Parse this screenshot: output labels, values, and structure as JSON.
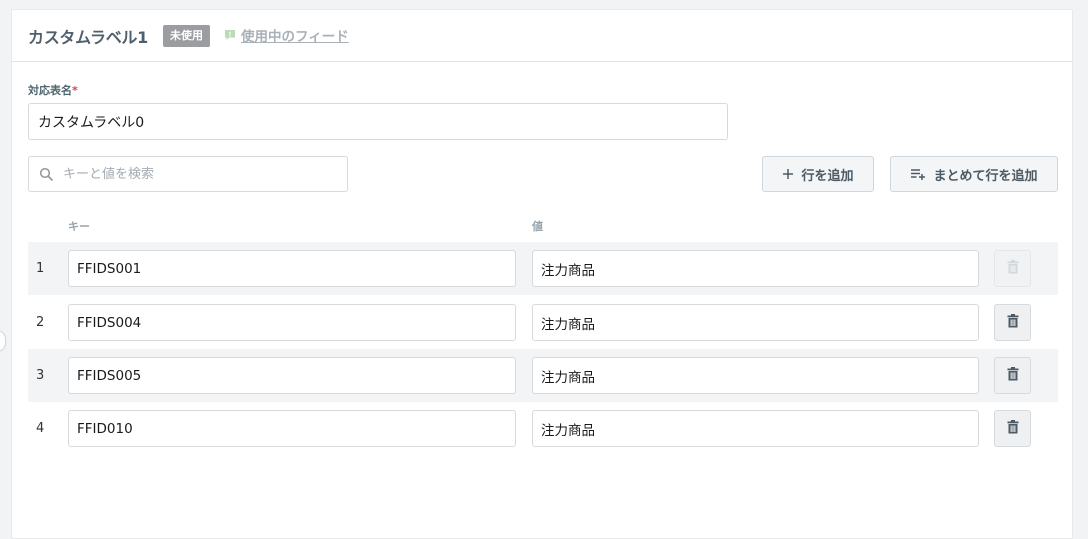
{
  "header": {
    "title": "カスタムラベル1",
    "status_badge": "未使用",
    "feed_link": "使用中のフィード"
  },
  "form": {
    "name_label": "対応表名",
    "required_mark": "*",
    "name_value": "カスタムラベル0"
  },
  "toolbar": {
    "search_placeholder": "キーと値を検索",
    "add_row_label": "行を追加",
    "bulk_add_label": "まとめて行を追加"
  },
  "table": {
    "columns": {
      "key": "キー",
      "value": "値"
    },
    "rows": [
      {
        "num": "1",
        "key": "FFIDS001",
        "value": "注力商品",
        "delete_enabled": false
      },
      {
        "num": "2",
        "key": "FFIDS004",
        "value": "注力商品",
        "delete_enabled": true
      },
      {
        "num": "3",
        "key": "FFIDS005",
        "value": "注力商品",
        "delete_enabled": true
      },
      {
        "num": "4",
        "key": "FFID010",
        "value": "注力商品",
        "delete_enabled": true
      }
    ]
  },
  "icons": {
    "feed": "speech-bubble-icon",
    "search": "search-icon",
    "add_row": "plus-icon",
    "bulk_add": "list-add-icon",
    "delete": "trash-icon"
  },
  "colors": {
    "badge_bg": "#9b9da0",
    "feed_icon": "#b9dcb2",
    "required": "#d0454c",
    "row_shade": "#f3f4f5"
  }
}
